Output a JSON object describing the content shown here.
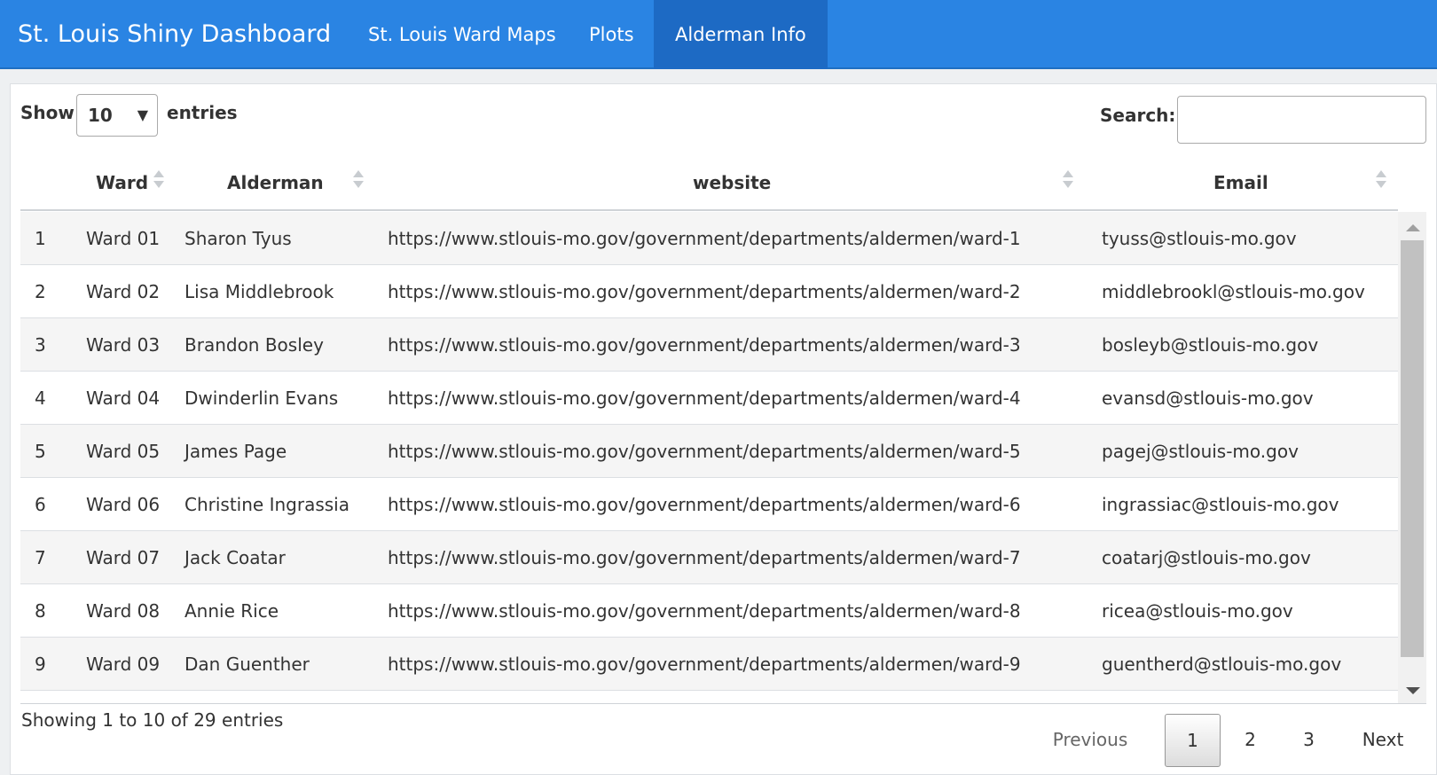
{
  "navbar": {
    "brand": "St. Louis Shiny Dashboard",
    "tabs": [
      {
        "label": "St. Louis Ward Maps",
        "active": false
      },
      {
        "label": "Plots",
        "active": false
      },
      {
        "label": "Alderman Info",
        "active": true
      }
    ],
    "color": "#2a84e3",
    "active_color": "#1d6ac4"
  },
  "controls": {
    "show_label": "Show",
    "entries_label": "entries",
    "page_length": "10",
    "search_label": "Search:",
    "search_value": ""
  },
  "table": {
    "columns": [
      {
        "label": "",
        "sortable": false
      },
      {
        "label": "Ward",
        "sortable": true
      },
      {
        "label": "Alderman",
        "sortable": true
      },
      {
        "label": "website",
        "sortable": true
      },
      {
        "label": "Email",
        "sortable": true
      }
    ],
    "rows": [
      {
        "n": "1",
        "ward": "Ward 01",
        "alderman": "Sharon Tyus",
        "website": "https://www.stlouis-mo.gov/government/departments/aldermen/ward-1",
        "email": "tyuss@stlouis-mo.gov"
      },
      {
        "n": "2",
        "ward": "Ward 02",
        "alderman": "Lisa Middlebrook",
        "website": "https://www.stlouis-mo.gov/government/departments/aldermen/ward-2",
        "email": "middlebrookl@stlouis-mo.gov"
      },
      {
        "n": "3",
        "ward": "Ward 03",
        "alderman": "Brandon Bosley",
        "website": "https://www.stlouis-mo.gov/government/departments/aldermen/ward-3",
        "email": "bosleyb@stlouis-mo.gov"
      },
      {
        "n": "4",
        "ward": "Ward 04",
        "alderman": "Dwinderlin Evans",
        "website": "https://www.stlouis-mo.gov/government/departments/aldermen/ward-4",
        "email": "evansd@stlouis-mo.gov"
      },
      {
        "n": "5",
        "ward": "Ward 05",
        "alderman": "James Page",
        "website": "https://www.stlouis-mo.gov/government/departments/aldermen/ward-5",
        "email": "pagej@stlouis-mo.gov"
      },
      {
        "n": "6",
        "ward": "Ward 06",
        "alderman": "Christine Ingrassia",
        "website": "https://www.stlouis-mo.gov/government/departments/aldermen/ward-6",
        "email": "ingrassiac@stlouis-mo.gov"
      },
      {
        "n": "7",
        "ward": "Ward 07",
        "alderman": "Jack Coatar",
        "website": "https://www.stlouis-mo.gov/government/departments/aldermen/ward-7",
        "email": "coatarj@stlouis-mo.gov"
      },
      {
        "n": "8",
        "ward": "Ward 08",
        "alderman": "Annie Rice",
        "website": "https://www.stlouis-mo.gov/government/departments/aldermen/ward-8",
        "email": "ricea@stlouis-mo.gov"
      },
      {
        "n": "9",
        "ward": "Ward 09",
        "alderman": "Dan Guenther",
        "website": "https://www.stlouis-mo.gov/government/departments/aldermen/ward-9",
        "email": "guentherd@stlouis-mo.gov"
      }
    ]
  },
  "footer": {
    "info": "Showing 1 to 10 of 29 entries",
    "pagination": {
      "previous": "Previous",
      "pages": [
        "1",
        "2",
        "3"
      ],
      "current": "1",
      "next": "Next"
    }
  }
}
